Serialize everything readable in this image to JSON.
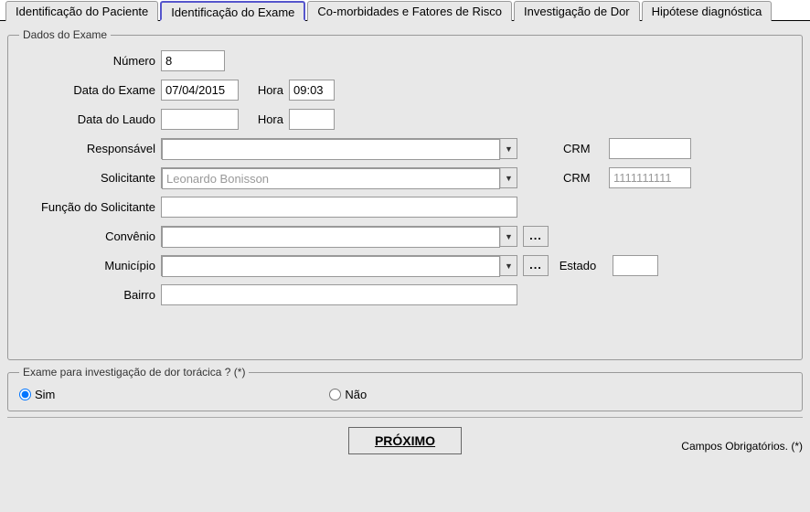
{
  "tabs": {
    "paciente": "Identificação do Paciente",
    "exame": "Identificação do Exame",
    "comorbidades": "Co-morbidades e Fatores de Risco",
    "investigacao": "Investigação de Dor",
    "hipotese": "Hipótese diagnóstica"
  },
  "exame": {
    "legend": "Dados do Exame",
    "labels": {
      "numero": "Número",
      "data_exame": "Data do Exame",
      "hora": "Hora",
      "data_laudo": "Data do Laudo",
      "responsavel": "Responsável",
      "solicitante": "Solicitante",
      "funcao_solicitante": "Função do Solicitante",
      "convenio": "Convênio",
      "municipio": "Município",
      "estado": "Estado",
      "bairro": "Bairro",
      "crm": "CRM"
    },
    "values": {
      "numero": "8",
      "data_exame": "07/04/2015",
      "hora_exame": "09:03",
      "data_laudo": "",
      "hora_laudo": "",
      "responsavel": "",
      "crm_responsavel": "",
      "solicitante": "Leonardo Bonisson",
      "crm_solicitante": "1111111111",
      "funcao_solicitante": "",
      "convenio": "",
      "municipio": "",
      "estado": "",
      "bairro": ""
    }
  },
  "investigacao": {
    "legend": "Exame para investigação de dor torácica ? (*)",
    "sim": "Sim",
    "nao": "Não",
    "selected": "sim"
  },
  "bottom": {
    "proximo": "PRÓXIMO",
    "obrigatorios": "Campos Obrigatórios. (*)"
  },
  "icons": {
    "ellipsis": "..."
  }
}
